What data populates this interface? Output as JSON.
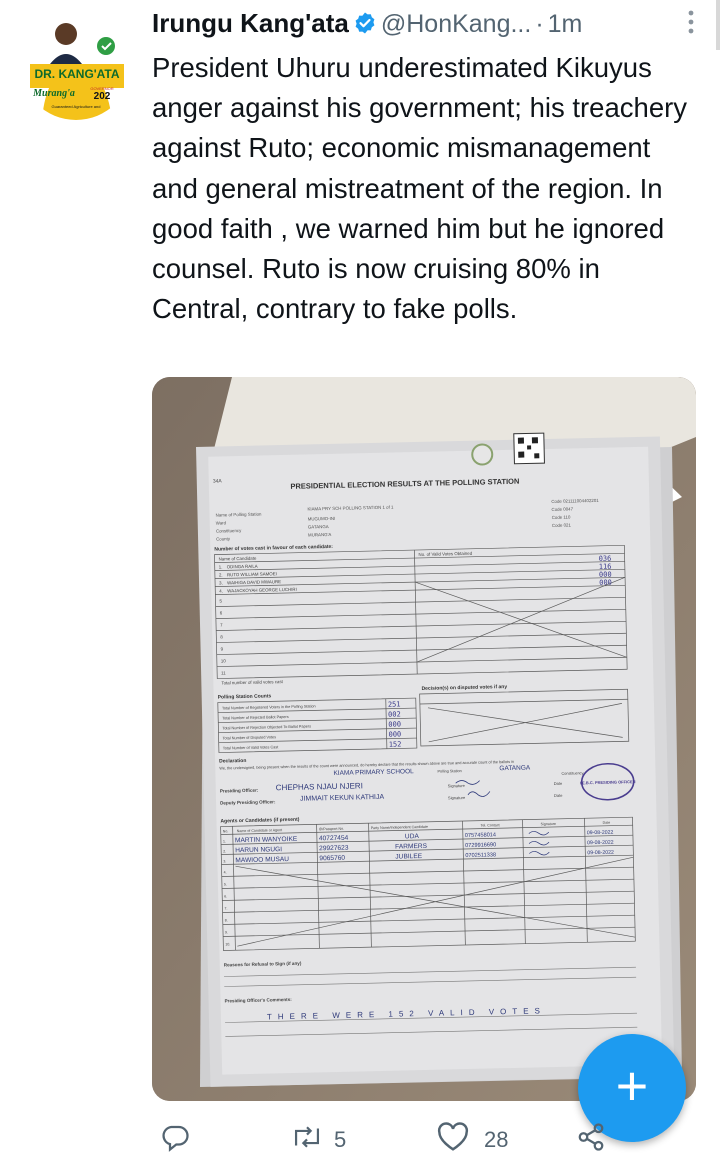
{
  "tweet": {
    "author_name": "Irungu Kang'ata",
    "handle": "@HonKang...",
    "separator": "·",
    "time": "1m",
    "text": "President Uhuru underestimated Kikuyus anger against his government; his treachery against Ruto; economic mismanagement and general mistreatment of the region. In good faith , we warned him but he ignored counsel. Ruto is now cruising 80% in Central, contrary to fake polls.",
    "avatar": {
      "name_text": "DR. KANG'ATA",
      "county_text": "Murang'a",
      "governor_text": "GOVERNOR",
      "year_text": "202",
      "slogan_text": "Guaranteed Agriculture and"
    }
  },
  "form": {
    "title": "PRESIDENTIAL ELECTION RESULTS AT THE POLLING STATION",
    "form_code": "34A",
    "header_fields": [
      {
        "label": "Name of Polling Station",
        "value": "KIAMA PRY SCH POLLING STATION 1 of 1"
      },
      {
        "label": "Ward",
        "value": "MUGUMO-INI"
      },
      {
        "label": "Constituency",
        "value": "GATANGA"
      },
      {
        "label": "County",
        "value": "MURANG'A"
      }
    ],
    "header_codes": [
      "Code  021111004402201",
      "Code  0047",
      "Code  110",
      "Code  021"
    ],
    "candidates_heading": "Number of votes cast in favour of each candidate:",
    "candidates_col1": "Name of Candidate",
    "candidates_col2": "No. of Valid Votes Obtained",
    "candidates": [
      {
        "num": "1.",
        "name": "ODINGA RAILA",
        "votes": "036"
      },
      {
        "num": "2.",
        "name": "RUTO WILLIAM SAMOEI",
        "votes": "116"
      },
      {
        "num": "3.",
        "name": "WAIHIGA DAVID MWAURE",
        "votes": "000"
      },
      {
        "num": "4.",
        "name": "WAJACKOYAH GEORGE LUCHIRI",
        "votes": "000"
      }
    ],
    "empty_rows": [
      "5",
      "6",
      "7",
      "8",
      "9",
      "10",
      "11"
    ],
    "total_valid_label": "Total number of valid votes cast",
    "counts_heading": "Polling Station Counts",
    "counts": [
      {
        "label": "Total Number of Registered Voters in the Polling Station",
        "value": "251"
      },
      {
        "label": "Total Number of Rejected Ballot Papers",
        "value": "002"
      },
      {
        "label": "Total Number of Rejection Objected To Ballot Papers",
        "value": "000"
      },
      {
        "label": "Total Number of Disputed Votes",
        "value": "000"
      },
      {
        "label": "Total Number of Valid Votes Cast",
        "value": "152"
      }
    ],
    "disputed_heading": "Decision(s) on disputed votes if any",
    "declaration_heading": "Declaration",
    "declaration_text": "We, the undersigned, being present when the results of the count were announced, do hereby declare that the results shown above are true and accurate count of the ballots in",
    "station_handwritten": "KIAMA PRIMARY SCHOOL",
    "station_label": "Polling Station",
    "constituency_handwritten": "GATANGA",
    "constituency_label": "Constituency",
    "presiding_label": "Presiding Officer:",
    "presiding_name": "CHEPHAS NJAU NJERI",
    "deputy_label": "Deputy Presiding Officer:",
    "deputy_name": "JIMMAIT KEKUN KATHIJA",
    "signature_label": "Signature",
    "date_label": "Date",
    "stamp_text": "I.E.B.C. PRESIDING OFFICER",
    "agents_heading": "Agents or Candidates (if present)",
    "agents_cols": [
      "No.",
      "Name of Candidate or Agent",
      "ID/Passport No.",
      "Party Name/Independent Candidate",
      "Tel. Contact",
      "Signature",
      "Date"
    ],
    "agents": [
      {
        "num": "1.",
        "name": "MARTIN WANYOIKE",
        "id": "40727454",
        "party": "UDA",
        "tel": "0757458014",
        "date": "09-08-2022"
      },
      {
        "num": "2.",
        "name": "HARUN NGUGI",
        "id": "29927623",
        "party": "FARMERS",
        "tel": "0729916690",
        "date": "09-08-2022"
      },
      {
        "num": "3.",
        "name": "MAWIOO MUSAU",
        "id": "9065760",
        "party": "JUBILEE",
        "tel": "0702511338",
        "date": "09-08-2022"
      }
    ],
    "agent_empty_rows": [
      "4.",
      "5.",
      "6.",
      "7.",
      "8.",
      "9.",
      "10."
    ],
    "refusal_label": "Reasons for Refusal to Sign (if any)",
    "comments_label": "Presiding Officer's Comments:",
    "comments_handwritten": "THERE WERE 152 VALID VOTES"
  },
  "actions": {
    "retweets": "5",
    "likes": "28"
  },
  "fab_label": "+",
  "colors": {
    "accent": "#1d9bf0",
    "text": "#0f1419",
    "secondary": "#536471"
  }
}
